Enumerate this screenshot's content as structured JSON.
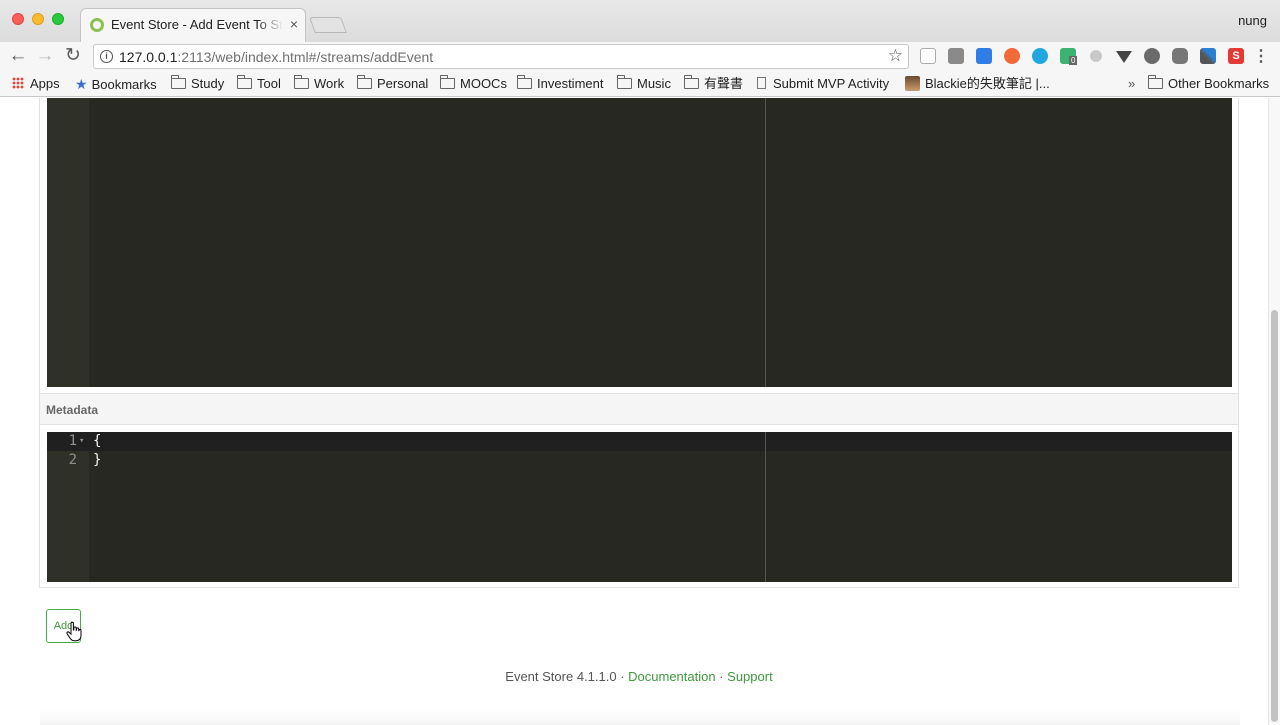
{
  "window": {
    "tab_title": "Event Store - Add Event To Stream",
    "tab_close": "×",
    "profile": "nung"
  },
  "toolbar": {
    "url_host": "127.0.0.1",
    "url_rest": ":2113/web/index.html#/streams/addEvent",
    "back_glyph": "←",
    "forward_glyph": "→",
    "reload_glyph": "↻",
    "info_glyph": "i",
    "star_glyph": "☆",
    "menu_glyph": "⋮",
    "ext_badge": "0",
    "ext_s_label": "S"
  },
  "bookmarks": {
    "apps": "Apps",
    "bookmarks": "Bookmarks",
    "study": "Study",
    "tool": "Tool",
    "work": "Work",
    "personal": "Personal",
    "moocs": "MOOCs",
    "investiment": "Investiment",
    "music": "Music",
    "audiobook": "有聲書",
    "submit_mvp": "Submit MVP Activity",
    "blackie": "Blackie的失敗筆記 |...",
    "overflow": "»",
    "other": "Other Bookmarks"
  },
  "main": {
    "metadata_label": "Metadata",
    "metadata_editor": {
      "lines": [
        {
          "number": "1",
          "code": "{"
        },
        {
          "number": "2",
          "code": "}"
        }
      ],
      "fold_glyph": "▾"
    },
    "add_button": "Add"
  },
  "footer": {
    "version": "Event Store 4.1.1.0",
    "sep1": " · ",
    "documentation": "Documentation",
    "sep2": " · ",
    "support": "Support"
  },
  "colors": {
    "editor_bg": "#272822",
    "accent_green": "#3d9a3d"
  }
}
